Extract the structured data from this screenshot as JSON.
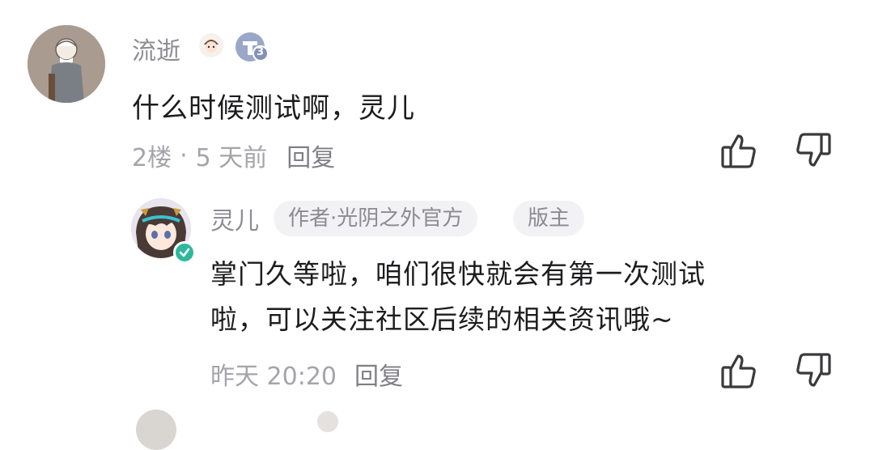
{
  "comment": {
    "username": "流逝",
    "level": "3",
    "text": "什么时候测试啊，灵儿",
    "floor": "2楼",
    "dot": "·",
    "time": "5 天前",
    "reply_label": "回复",
    "icons": [
      "avatar",
      "emoji-badge-icon",
      "level-badge-icon",
      "thumbs-up-icon",
      "thumbs-down-icon"
    ]
  },
  "reply": {
    "username": "灵儿",
    "tag_author": "作者·光阴之外官方",
    "tag_moderator": "版主",
    "text_line1": "掌门久等啦，咱们很快就会有第一次测试",
    "text_line2": "啦，可以关注社区后续的相关资讯哦~",
    "time": "昨天 20:20",
    "reply_label": "回复",
    "icons": [
      "avatar",
      "verified-icon",
      "thumbs-up-icon",
      "thumbs-down-icon"
    ]
  },
  "colors": {
    "meta_text": "#a4a4aa",
    "username_text": "#8d8d93",
    "verified": "#2fb89d",
    "level_badge": "#9aa7c7"
  }
}
